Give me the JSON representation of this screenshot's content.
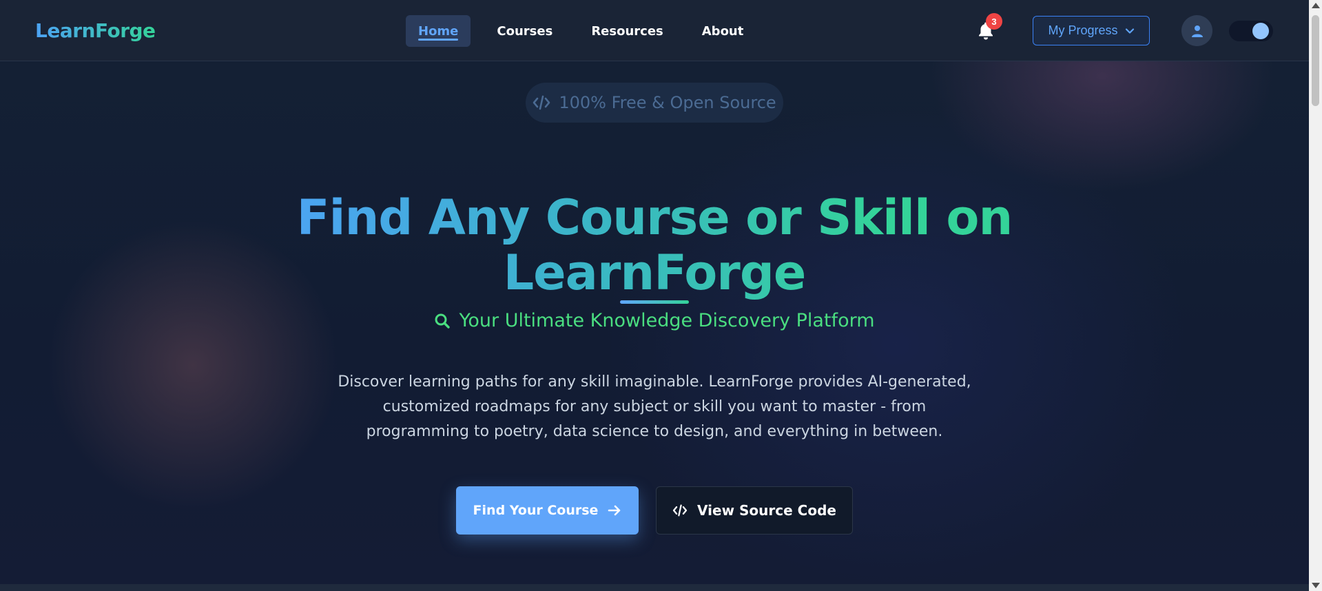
{
  "nav": {
    "logo": "LearnForge",
    "links": [
      {
        "label": "Home",
        "active": true
      },
      {
        "label": "Courses",
        "active": false
      },
      {
        "label": "Resources",
        "active": false
      },
      {
        "label": "About",
        "active": false
      }
    ],
    "notification_count": "3",
    "progress_label": "My Progress",
    "icons": {
      "bell": "bell-icon",
      "chevron": "chevron-down-icon",
      "user": "user-icon"
    },
    "theme_toggle_on": true
  },
  "hero": {
    "pill_label": "100% Free & Open Source",
    "title": "Find Any Course or Skill on LearnForge",
    "subtitle": "Your Ultimate Knowledge Discovery Platform",
    "description": "Discover learning paths for any skill imaginable. LearnForge provides AI-generated, customized roadmaps for any subject or skill you want to master - from programming to poetry, data science to design, and everything in between.",
    "primary_button": "Find Your Course",
    "secondary_button": "View Source Code"
  },
  "colors": {
    "accent_blue": "#60a5fa",
    "accent_green": "#34d399",
    "badge_red": "#ef4444",
    "background": "#142134"
  }
}
